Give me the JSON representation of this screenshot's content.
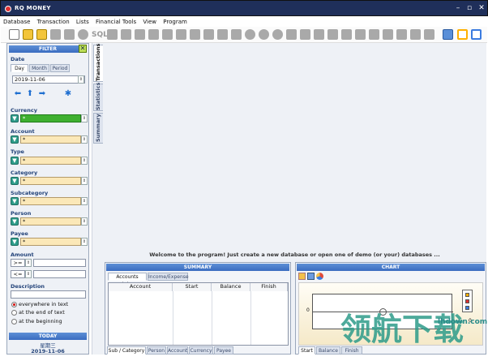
{
  "app": {
    "title": "RQ MONEY"
  },
  "menu": [
    "Database",
    "Transaction",
    "Lists",
    "Financial Tools",
    "View",
    "Program"
  ],
  "toolbar": {
    "sql_label": "SQL"
  },
  "filter": {
    "header": "FILTER",
    "date_label": "Date",
    "date_tabs": [
      "Day",
      "Month",
      "Period"
    ],
    "date_value": "2019-11-06",
    "currency_label": "Currency",
    "currency_value": "*",
    "account_label": "Account",
    "account_value": "*",
    "type_label": "Type",
    "type_value": "*",
    "category_label": "Category",
    "category_value": "*",
    "subcategory_label": "Subcategory",
    "subcategory_value": "*",
    "person_label": "Person",
    "person_value": "*",
    "payee_label": "Payee",
    "payee_value": "*",
    "amount_label": "Amount",
    "amount_ge": ">=",
    "amount_le": "<=",
    "description_label": "Description",
    "desc_options": [
      "everywhere in text",
      "at the end of text",
      "at the beginning"
    ],
    "today_header": "TODAY",
    "today_weekday": "星期三",
    "today_date": "2019-11-06"
  },
  "vtabs": [
    "Transactions",
    "Statistics",
    "Summary X"
  ],
  "welcome": "Welcome to the program!  Just create a new database or open one of demo (or your) databases ...",
  "summary": {
    "header": "SUMMARY",
    "tabs": [
      "Accounts status",
      "Income/Expense"
    ],
    "columns": [
      "Account",
      "Start",
      "Balance",
      "Finish"
    ],
    "bottom_tabs": [
      "Sub / Category",
      "Person",
      "Account",
      "Currency",
      "Payee"
    ]
  },
  "chart": {
    "header": "CHART",
    "axis_value": "0",
    "bottom_tabs": [
      "Start",
      "Balance",
      "Finish"
    ]
  },
  "watermark": {
    "main": "领航下载",
    "url": "lhdown.com"
  },
  "colors": {
    "titlebar": "#1f2f5a",
    "header": "#3a6cc0",
    "field": "#fbe8b8",
    "filter_btn": "#2e9c8a"
  }
}
